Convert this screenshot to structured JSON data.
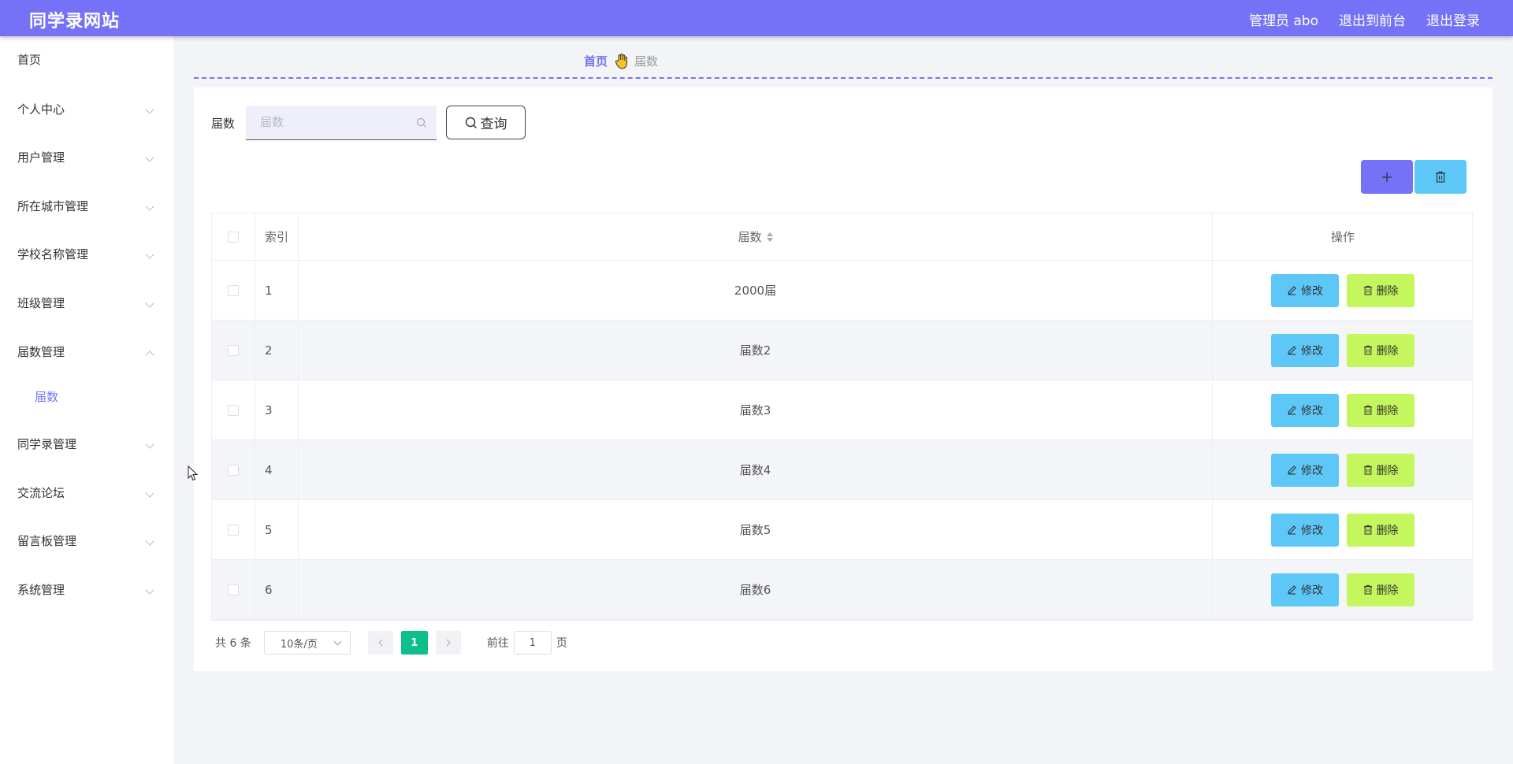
{
  "header": {
    "title": "同学录网站",
    "admin": "管理员 abo",
    "to_front": "退出到前台",
    "logout": "退出登录"
  },
  "sidebar": {
    "items": [
      {
        "label": "首页"
      },
      {
        "label": "个人中心"
      },
      {
        "label": "用户管理"
      },
      {
        "label": "所在城市管理"
      },
      {
        "label": "学校名称管理"
      },
      {
        "label": "班级管理"
      },
      {
        "label": "届数管理"
      },
      {
        "label": "届数"
      },
      {
        "label": "同学录管理"
      },
      {
        "label": "交流论坛"
      },
      {
        "label": "留言板管理"
      },
      {
        "label": "系统管理"
      }
    ]
  },
  "breadcrumb": {
    "home": "首页",
    "current": "届数"
  },
  "search": {
    "label": "届数",
    "placeholder": "届数",
    "button": "查询"
  },
  "table": {
    "headers": {
      "index": "索引",
      "year": "届数",
      "ops": "操作"
    },
    "edit_label": "修改",
    "delete_label": "删除",
    "rows": [
      {
        "index": "1",
        "year": "2000届"
      },
      {
        "index": "2",
        "year": "届数2"
      },
      {
        "index": "3",
        "year": "届数3"
      },
      {
        "index": "4",
        "year": "届数4"
      },
      {
        "index": "5",
        "year": "届数5"
      },
      {
        "index": "6",
        "year": "届数6"
      }
    ]
  },
  "pagination": {
    "total": "共 6 条",
    "page_size": "10条/页",
    "current_page": "1",
    "goto_prefix": "前往",
    "goto_value": "1",
    "goto_suffix": "页"
  },
  "colors": {
    "primary": "#7572f7",
    "edit": "#5dc8f8",
    "delete": "#c4f75d",
    "page_active": "#0fbf8b"
  }
}
